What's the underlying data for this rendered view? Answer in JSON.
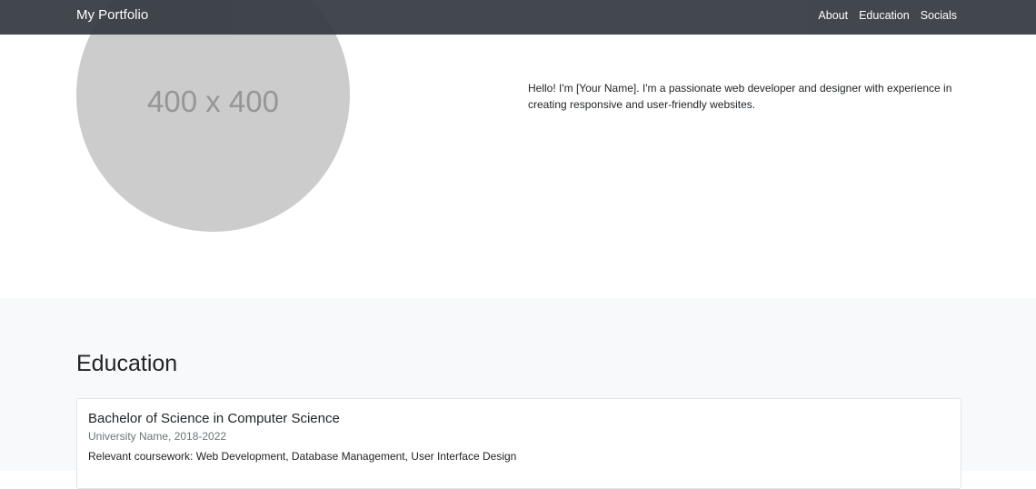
{
  "navbar": {
    "brand": "My Portfolio",
    "links": [
      "About",
      "Education",
      "Socials"
    ]
  },
  "hero": {
    "profile_image_label": "400 x 400",
    "about_text": "Hello! I'm [Your Name]. I'm a passionate web developer and designer with experience in creating responsive and user-friendly websites."
  },
  "education": {
    "title": "Education",
    "entries": [
      {
        "degree": "Bachelor of Science in Computer Science",
        "school": "University Name, 2018-2022",
        "coursework": "Relevant coursework: Web Development, Database Management, User Interface Design"
      }
    ]
  },
  "colors": {
    "navbar_bg": "#343a40",
    "section_bg": "#f8f9fa",
    "placeholder_bg": "#cccccc",
    "muted_text": "#6c757d"
  }
}
